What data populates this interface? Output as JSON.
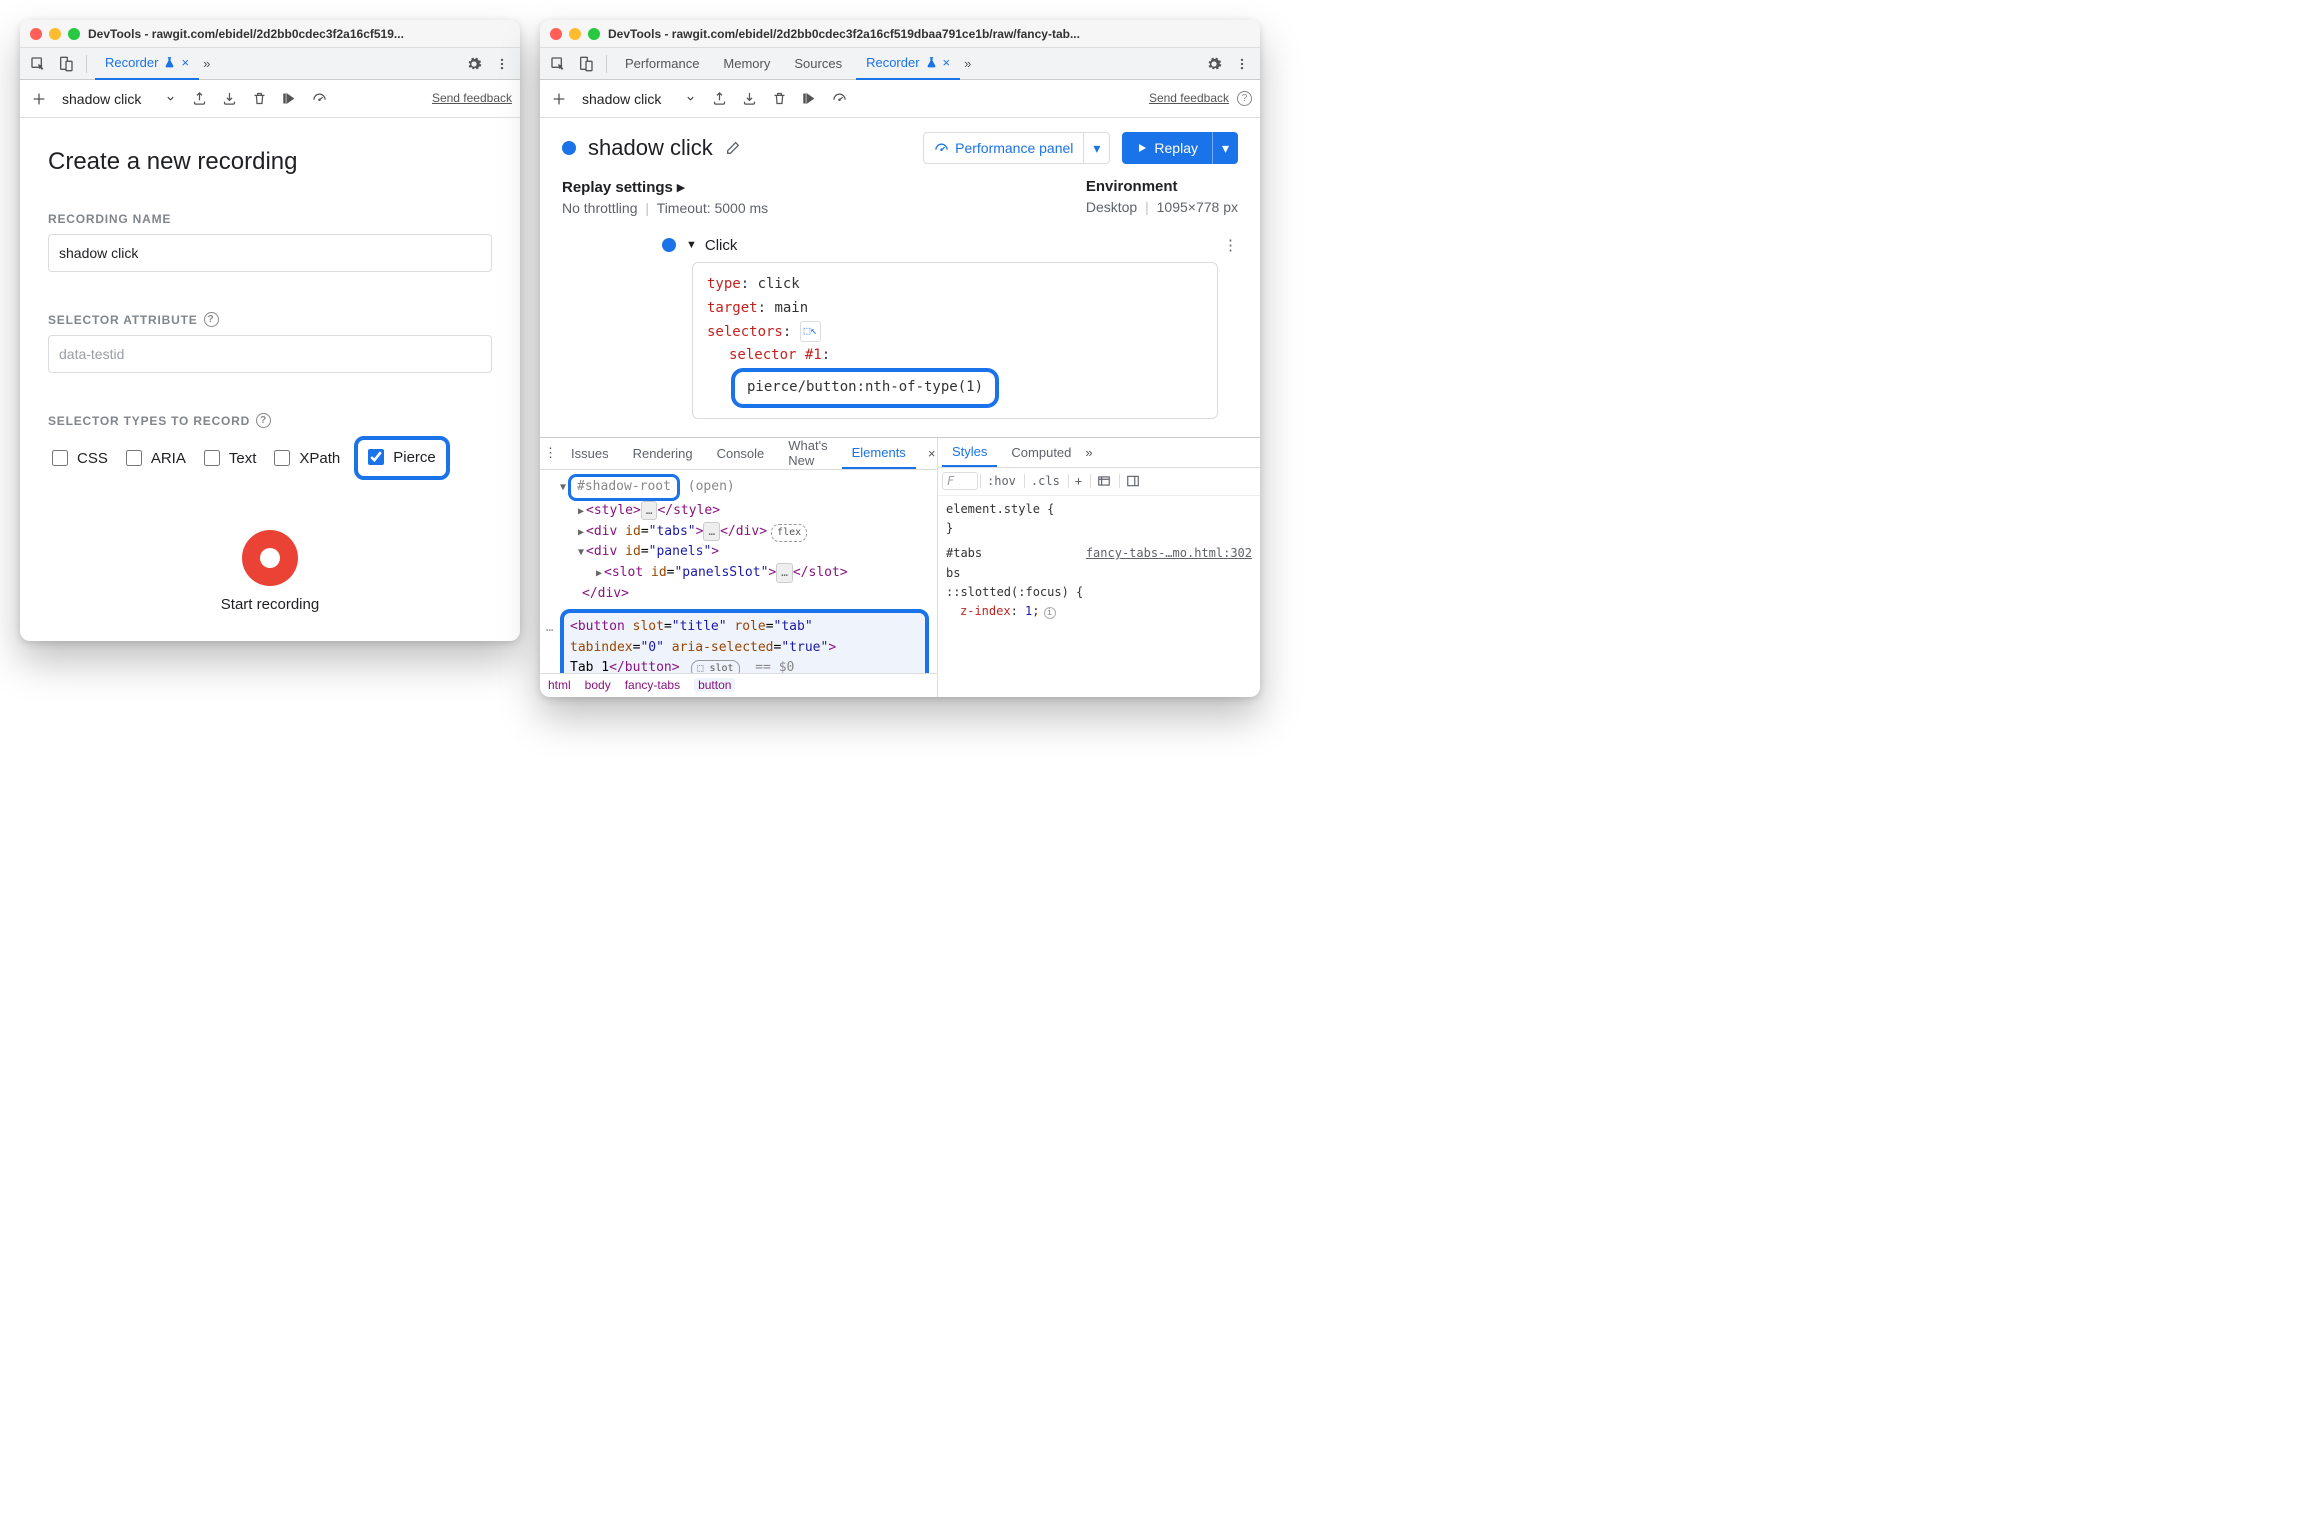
{
  "left": {
    "title": "DevTools - rawgit.com/ebidel/2d2bb0cdec3f2a16cf519...",
    "tabs": {
      "recorder": "Recorder"
    },
    "recorder_bar": {
      "recording_name": "shadow click",
      "send_feedback": "Send feedback"
    },
    "form": {
      "heading": "Create a new recording",
      "name_label": "RECORDING NAME",
      "name_value": "shadow click",
      "selector_attr_label": "SELECTOR ATTRIBUTE",
      "selector_attr_placeholder": "data-testid",
      "types_label": "SELECTOR TYPES TO RECORD",
      "types": {
        "css": "CSS",
        "aria": "ARIA",
        "text": "Text",
        "xpath": "XPath",
        "pierce": "Pierce"
      },
      "start": "Start recording"
    }
  },
  "right": {
    "title": "DevTools - rawgit.com/ebidel/2d2bb0cdec3f2a16cf519dbaa791ce1b/raw/fancy-tab...",
    "tabs": {
      "performance": "Performance",
      "memory": "Memory",
      "sources": "Sources",
      "recorder": "Recorder"
    },
    "recorder_bar": {
      "recording_name": "shadow click",
      "send_feedback": "Send feedback"
    },
    "rec": {
      "title": "shadow click",
      "perf_panel": "Performance panel",
      "replay": "Replay"
    },
    "settings": {
      "replay_head": "Replay settings",
      "throttling": "No throttling",
      "timeout": "Timeout: 5000 ms",
      "env_head": "Environment",
      "device": "Desktop",
      "dims": "1095×778 px"
    },
    "step": {
      "name": "Click",
      "type_k": "type",
      "type_v": "click",
      "target_k": "target",
      "target_v": "main",
      "selectors_k": "selectors",
      "sel1_k": "selector #1",
      "sel1_v": "pierce/button:nth-of-type(1)"
    },
    "drawer_tabs": {
      "issues": "Issues",
      "rendering": "Rendering",
      "console": "Console",
      "whatsnew": "What's New",
      "elements": "Elements"
    },
    "dom": {
      "shadow_root": "#shadow-root",
      "shadow_mode": "(open)",
      "style_tag": "<style>",
      "style_close": "</style>",
      "div_tabs_open": "<div id=\"tabs\">",
      "div_close": "</div>",
      "div_panels_open": "<div id=\"panels\">",
      "slot_panels": "<slot id=\"panelsSlot\">",
      "slot_close": "</slot>",
      "sel_open1": "<button slot=\"title\" role=\"tab\"",
      "sel_open2": "tabindex=\"0\" aria-selected=\"true\">",
      "sel_text": "Tab 1",
      "sel_close": "</button>",
      "slot_pill": "slot",
      "flex_pill": "flex",
      "eq0": "== $0"
    },
    "crumbs": {
      "html": "html",
      "body": "body",
      "fancy": "fancy-tabs",
      "button": "button"
    },
    "styles": {
      "tab_styles": "Styles",
      "tab_computed": "Computed",
      "filter_placeholder": "F",
      "hov": ":hov",
      "cls": ".cls",
      "elem_style": "element.style {",
      "brace_close": "}",
      "selector": "#tabs",
      "file": "fancy-tabs-…mo.html:302",
      "slotted": "::slotted(:focus) {",
      "zidx_n": "z-index",
      "zidx_v": "1"
    }
  }
}
